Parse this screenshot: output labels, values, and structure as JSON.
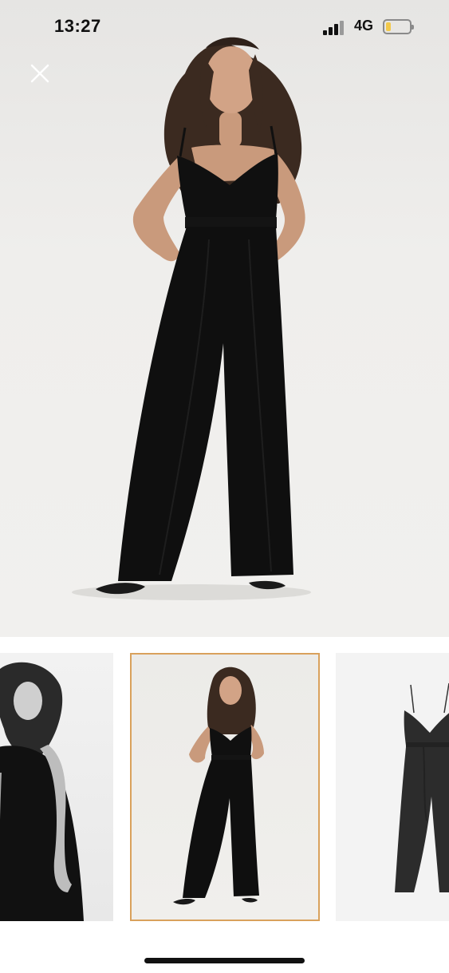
{
  "status_bar": {
    "time": "13:27",
    "network": "4G",
    "signal_icon": "signal-bars-icon",
    "battery_icon": "battery-icon",
    "battery_level": 0.2,
    "battery_color": "#f2c94c"
  },
  "header": {
    "close_icon": "close-icon"
  },
  "gallery": {
    "main_image": "model-black-jumpsuit-front",
    "thumbnails": [
      {
        "image": "model-black-jumpsuit-editorial-grayscale",
        "selected": false
      },
      {
        "image": "model-black-jumpsuit-front",
        "selected": true
      },
      {
        "image": "black-jumpsuit-product-flat",
        "selected": false
      }
    ],
    "selected_border_color": "#d9a15c"
  },
  "colors": {
    "garment": "#0f0f0f",
    "background": "#efeeec"
  }
}
